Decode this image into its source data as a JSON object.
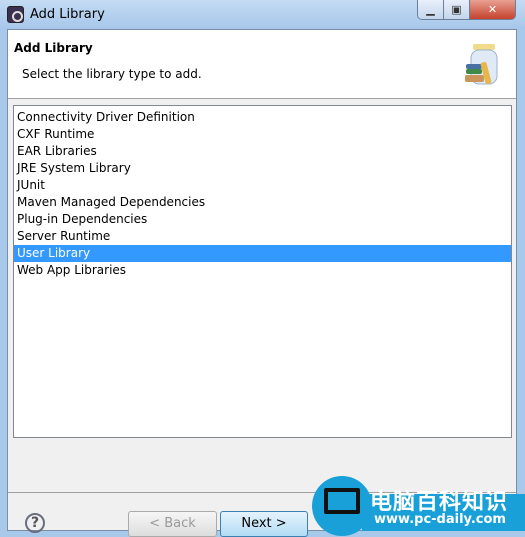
{
  "window": {
    "title": "Add Library",
    "icon": "eclipse-gear-icon"
  },
  "header": {
    "title": "Add Library",
    "description": "Select the library type to add.",
    "icon": "library-jar-icon"
  },
  "list": {
    "items": [
      "Connectivity Driver Definition",
      "CXF Runtime",
      "EAR Libraries",
      "JRE System Library",
      "JUnit",
      "Maven Managed Dependencies",
      "Plug-in Dependencies",
      "Server Runtime",
      "User Library",
      "Web App Libraries"
    ],
    "selected": "User Library",
    "selection_color": "#3399ff"
  },
  "buttons": {
    "help": "?",
    "back": "< Back",
    "next": "Next >"
  },
  "watermark": {
    "title": "电脑百科知识",
    "url": "www.pc-daily.com"
  }
}
